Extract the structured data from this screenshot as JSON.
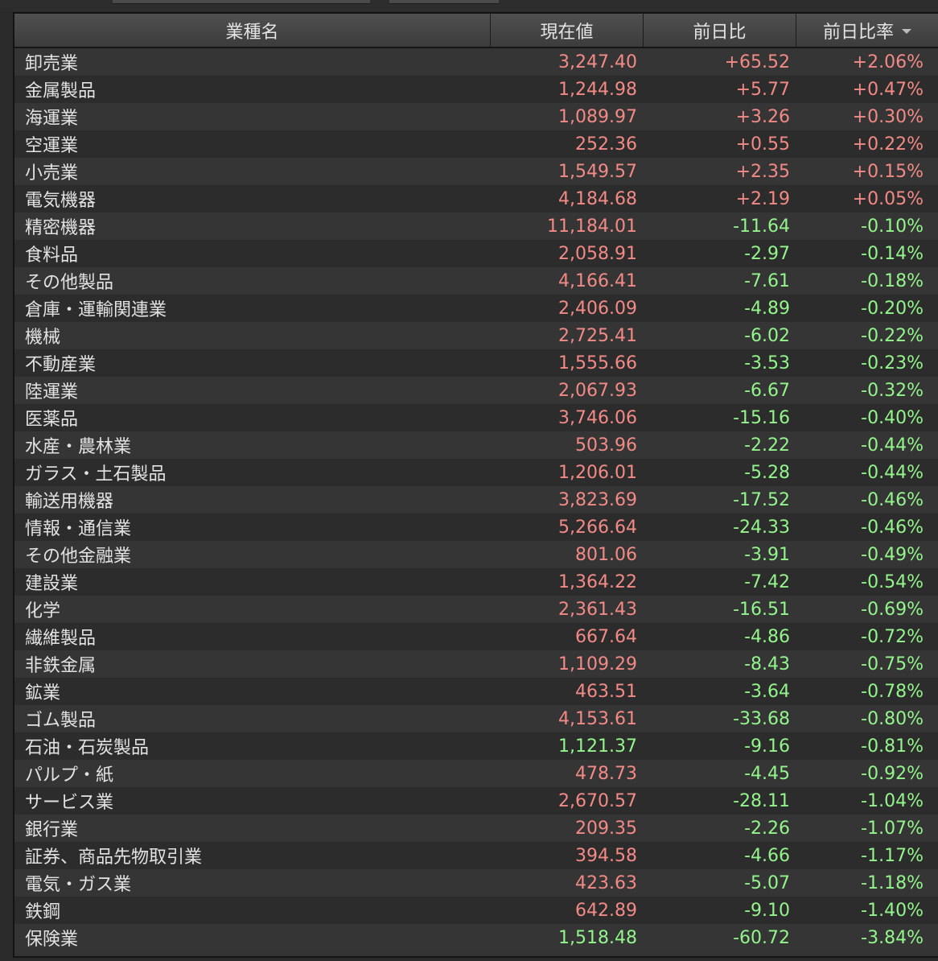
{
  "colors": {
    "up": "#f28a86",
    "down": "#93f58b",
    "text": "#e2e2e2"
  },
  "header": {
    "name": "業種名",
    "price": "現在値",
    "change": "前日比",
    "pct": "前日比率",
    "sort_icon": "sort-desc-icon"
  },
  "rows": [
    {
      "name": "卸売業",
      "price": "3,247.40",
      "change": "+65.52",
      "pct": "+2.06%",
      "price_dir": "up",
      "dir": "up"
    },
    {
      "name": "金属製品",
      "price": "1,244.98",
      "change": "+5.77",
      "pct": "+0.47%",
      "price_dir": "up",
      "dir": "up"
    },
    {
      "name": "海運業",
      "price": "1,089.97",
      "change": "+3.26",
      "pct": "+0.30%",
      "price_dir": "up",
      "dir": "up"
    },
    {
      "name": "空運業",
      "price": "252.36",
      "change": "+0.55",
      "pct": "+0.22%",
      "price_dir": "up",
      "dir": "up"
    },
    {
      "name": "小売業",
      "price": "1,549.57",
      "change": "+2.35",
      "pct": "+0.15%",
      "price_dir": "up",
      "dir": "up"
    },
    {
      "name": "電気機器",
      "price": "4,184.68",
      "change": "+2.19",
      "pct": "+0.05%",
      "price_dir": "up",
      "dir": "up"
    },
    {
      "name": "精密機器",
      "price": "11,184.01",
      "change": "-11.64",
      "pct": "-0.10%",
      "price_dir": "up",
      "dir": "down"
    },
    {
      "name": "食料品",
      "price": "2,058.91",
      "change": "-2.97",
      "pct": "-0.14%",
      "price_dir": "up",
      "dir": "down"
    },
    {
      "name": "その他製品",
      "price": "4,166.41",
      "change": "-7.61",
      "pct": "-0.18%",
      "price_dir": "up",
      "dir": "down"
    },
    {
      "name": "倉庫・運輸関連業",
      "price": "2,406.09",
      "change": "-4.89",
      "pct": "-0.20%",
      "price_dir": "up",
      "dir": "down"
    },
    {
      "name": "機械",
      "price": "2,725.41",
      "change": "-6.02",
      "pct": "-0.22%",
      "price_dir": "up",
      "dir": "down"
    },
    {
      "name": "不動産業",
      "price": "1,555.66",
      "change": "-3.53",
      "pct": "-0.23%",
      "price_dir": "up",
      "dir": "down"
    },
    {
      "name": "陸運業",
      "price": "2,067.93",
      "change": "-6.67",
      "pct": "-0.32%",
      "price_dir": "up",
      "dir": "down"
    },
    {
      "name": "医薬品",
      "price": "3,746.06",
      "change": "-15.16",
      "pct": "-0.40%",
      "price_dir": "up",
      "dir": "down"
    },
    {
      "name": "水産・農林業",
      "price": "503.96",
      "change": "-2.22",
      "pct": "-0.44%",
      "price_dir": "up",
      "dir": "down"
    },
    {
      "name": "ガラス・土石製品",
      "price": "1,206.01",
      "change": "-5.28",
      "pct": "-0.44%",
      "price_dir": "up",
      "dir": "down"
    },
    {
      "name": "輸送用機器",
      "price": "3,823.69",
      "change": "-17.52",
      "pct": "-0.46%",
      "price_dir": "up",
      "dir": "down"
    },
    {
      "name": "情報・通信業",
      "price": "5,266.64",
      "change": "-24.33",
      "pct": "-0.46%",
      "price_dir": "up",
      "dir": "down"
    },
    {
      "name": "その他金融業",
      "price": "801.06",
      "change": "-3.91",
      "pct": "-0.49%",
      "price_dir": "up",
      "dir": "down"
    },
    {
      "name": "建設業",
      "price": "1,364.22",
      "change": "-7.42",
      "pct": "-0.54%",
      "price_dir": "up",
      "dir": "down"
    },
    {
      "name": "化学",
      "price": "2,361.43",
      "change": "-16.51",
      "pct": "-0.69%",
      "price_dir": "up",
      "dir": "down"
    },
    {
      "name": "繊維製品",
      "price": "667.64",
      "change": "-4.86",
      "pct": "-0.72%",
      "price_dir": "up",
      "dir": "down"
    },
    {
      "name": "非鉄金属",
      "price": "1,109.29",
      "change": "-8.43",
      "pct": "-0.75%",
      "price_dir": "up",
      "dir": "down"
    },
    {
      "name": "鉱業",
      "price": "463.51",
      "change": "-3.64",
      "pct": "-0.78%",
      "price_dir": "up",
      "dir": "down"
    },
    {
      "name": "ゴム製品",
      "price": "4,153.61",
      "change": "-33.68",
      "pct": "-0.80%",
      "price_dir": "up",
      "dir": "down"
    },
    {
      "name": "石油・石炭製品",
      "price": "1,121.37",
      "change": "-9.16",
      "pct": "-0.81%",
      "price_dir": "down",
      "dir": "down"
    },
    {
      "name": "パルプ・紙",
      "price": "478.73",
      "change": "-4.45",
      "pct": "-0.92%",
      "price_dir": "up",
      "dir": "down"
    },
    {
      "name": "サービス業",
      "price": "2,670.57",
      "change": "-28.11",
      "pct": "-1.04%",
      "price_dir": "up",
      "dir": "down"
    },
    {
      "name": "銀行業",
      "price": "209.35",
      "change": "-2.26",
      "pct": "-1.07%",
      "price_dir": "up",
      "dir": "down"
    },
    {
      "name": "証券、商品先物取引業",
      "price": "394.58",
      "change": "-4.66",
      "pct": "-1.17%",
      "price_dir": "up",
      "dir": "down"
    },
    {
      "name": "電気・ガス業",
      "price": "423.63",
      "change": "-5.07",
      "pct": "-1.18%",
      "price_dir": "up",
      "dir": "down"
    },
    {
      "name": "鉄鋼",
      "price": "642.89",
      "change": "-9.10",
      "pct": "-1.40%",
      "price_dir": "up",
      "dir": "down"
    },
    {
      "name": "保険業",
      "price": "1,518.48",
      "change": "-60.72",
      "pct": "-3.84%",
      "price_dir": "down",
      "dir": "down"
    }
  ]
}
